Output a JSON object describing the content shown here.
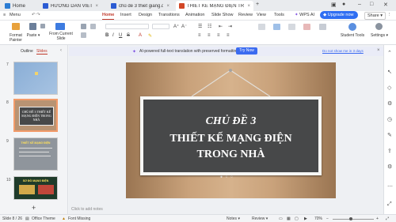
{
  "tabs": [
    {
      "label": "Home",
      "color": "#2b7cd3"
    },
    {
      "label": "HƯỚNG DẪN VIẾT TIN.docx",
      "color": "#2b5bd3"
    },
    {
      "label": "chủ đề 3 thiet giang.docx",
      "color": "#2b5bd3"
    },
    {
      "label": "THIẾT KẾ MẠNG ĐIỆN TRONG",
      "color": "#d24726"
    }
  ],
  "menu": {
    "main_menu": "Menu",
    "items": [
      "Home",
      "Insert",
      "Design",
      "Transitions",
      "Animation",
      "Slide Show",
      "Review",
      "View",
      "Tools",
      "WPS AI"
    ],
    "active": "Home",
    "upgrade": "Upgrade now",
    "share": "Share"
  },
  "ribbon": {
    "format_painter": "Format Painter",
    "paste": "Paste",
    "from_current_slide": "From Current Slide",
    "student_tools": "Student Tools",
    "settings": "Settings"
  },
  "panel": {
    "outline_tab": "Outline",
    "slides_tab": "Slides",
    "thumbs": [
      {
        "num": "7",
        "title": ""
      },
      {
        "num": "8",
        "title": "CHỦ ĐỀ 3 THIẾT KẾ MẠNG ĐIỆN TRONG NHÀ"
      },
      {
        "num": "9",
        "title": "THIẾT KẾ MẠNG ĐIỆN"
      },
      {
        "num": "10",
        "title": "SƠ ĐỒ MẠNG ĐIỆN"
      }
    ],
    "add": "+"
  },
  "banner": {
    "text": "AI-powered full-text translation with preserved formatting.",
    "button": "Try Now",
    "dismiss": "Do not show me in 3 days"
  },
  "slide": {
    "line1": "CHỦ ĐỀ 3",
    "line2": "THIẾT KẾ MẠNG ĐIỆN",
    "line3": "TRONG NHÀ"
  },
  "notes_placeholder": "Click to add notes",
  "status": {
    "slide_info": "Slide 8 / 26",
    "theme": "Office Theme",
    "font": "Font Missing",
    "notes": "Notes",
    "review": "Review",
    "zoom": "70%"
  }
}
